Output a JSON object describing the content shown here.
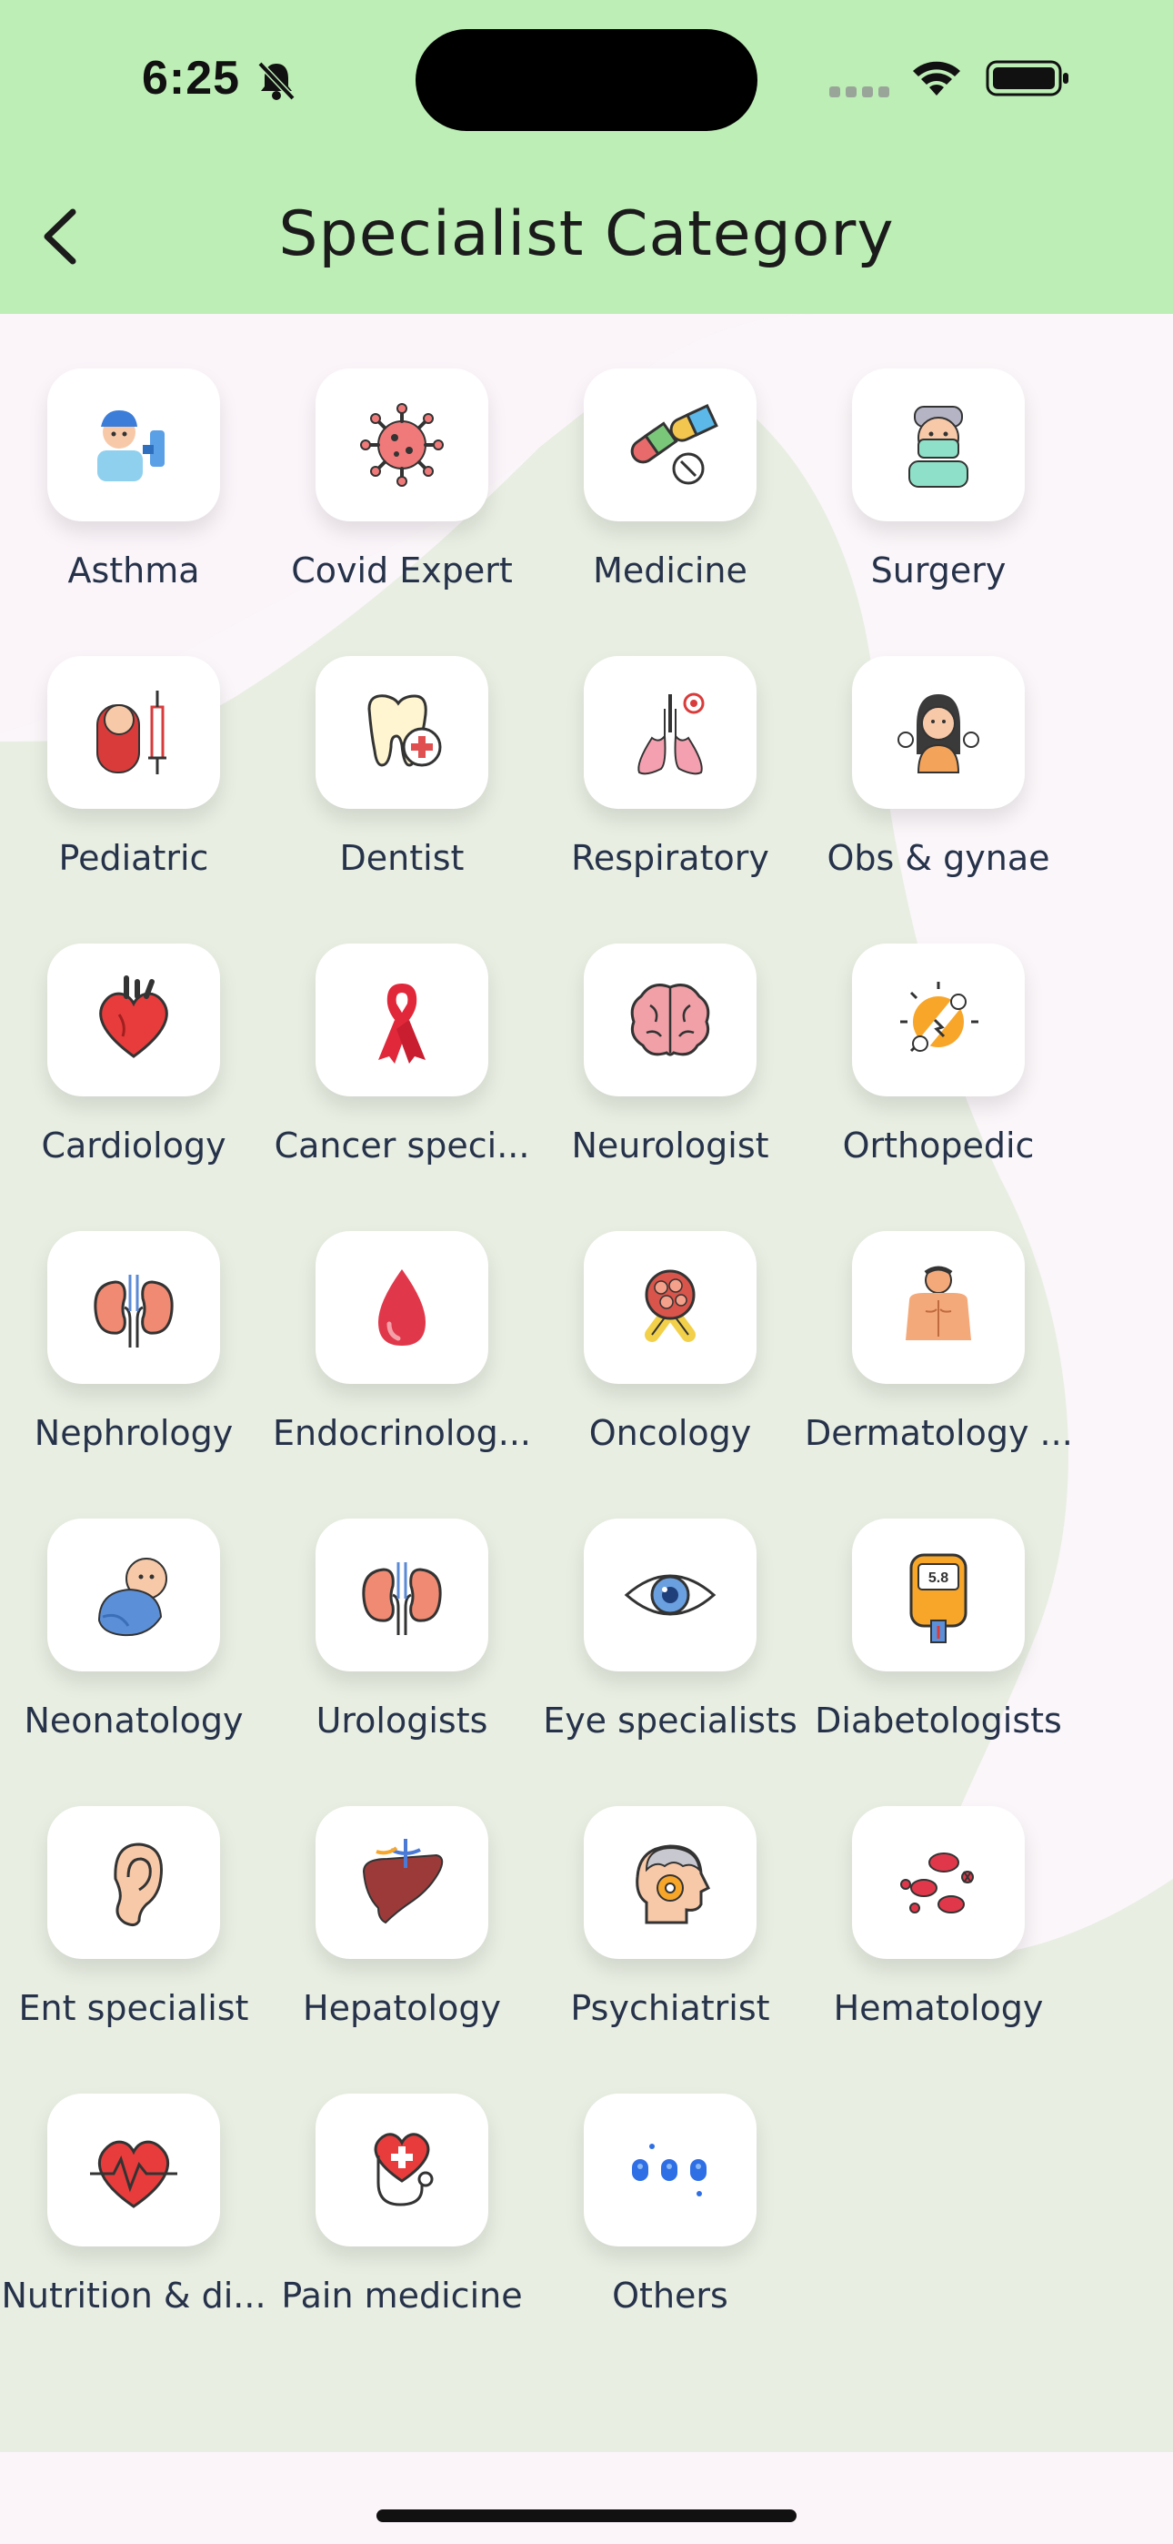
{
  "status": {
    "time": "6:25",
    "icons": [
      "bell-slash-icon",
      "cellular-signal-icon",
      "wifi-icon",
      "battery-icon"
    ]
  },
  "header": {
    "title": "Specialist Category",
    "back_icon": "chevron-left-icon"
  },
  "colors": {
    "header_bg": "#bdeeb6",
    "content_bg": "#e8eee2",
    "card_bg": "#ffffff",
    "label_color": "#26324a"
  },
  "categories": [
    {
      "label": "Asthma",
      "icon": "asthma-icon"
    },
    {
      "label": "Covid Expert",
      "icon": "virus-icon"
    },
    {
      "label": "Medicine",
      "icon": "pills-icon"
    },
    {
      "label": "Surgery",
      "icon": "surgeon-icon"
    },
    {
      "label": "Pediatric",
      "icon": "baby-syringe-icon"
    },
    {
      "label": "Dentist",
      "icon": "tooth-icon"
    },
    {
      "label": "Respiratory",
      "icon": "lungs-icon"
    },
    {
      "label": "Obs & gynae",
      "icon": "woman-gender-icon"
    },
    {
      "label": "Cardiology",
      "icon": "heart-icon"
    },
    {
      "label": "Cancer speci...",
      "icon": "ribbon-icon"
    },
    {
      "label": "Neurologist",
      "icon": "brain-icon"
    },
    {
      "label": "Orthopedic",
      "icon": "broken-bone-icon"
    },
    {
      "label": "Nephrology",
      "icon": "kidneys-icon"
    },
    {
      "label": "Endocrinolog...",
      "icon": "blood-drop-icon"
    },
    {
      "label": "Oncology",
      "icon": "tumor-ribbon-icon"
    },
    {
      "label": "Dermatology ...",
      "icon": "skin-body-icon"
    },
    {
      "label": "Neonatology",
      "icon": "newborn-icon"
    },
    {
      "label": "Urologists",
      "icon": "kidneys-icon"
    },
    {
      "label": "Eye specialists",
      "icon": "eye-icon"
    },
    {
      "label": "Diabetologists",
      "icon": "glucometer-icon"
    },
    {
      "label": "Ent specialist",
      "icon": "ear-icon"
    },
    {
      "label": "Hepatology",
      "icon": "liver-icon"
    },
    {
      "label": "Psychiatrist",
      "icon": "head-gear-icon"
    },
    {
      "label": "Hematology",
      "icon": "blood-cells-icon"
    },
    {
      "label": "Nutrition & di...",
      "icon": "heartbeat-icon"
    },
    {
      "label": "Pain medicine",
      "icon": "heart-stethoscope-icon"
    },
    {
      "label": "Others",
      "icon": "dots-icon"
    }
  ],
  "glucometer_reading": "5.8"
}
